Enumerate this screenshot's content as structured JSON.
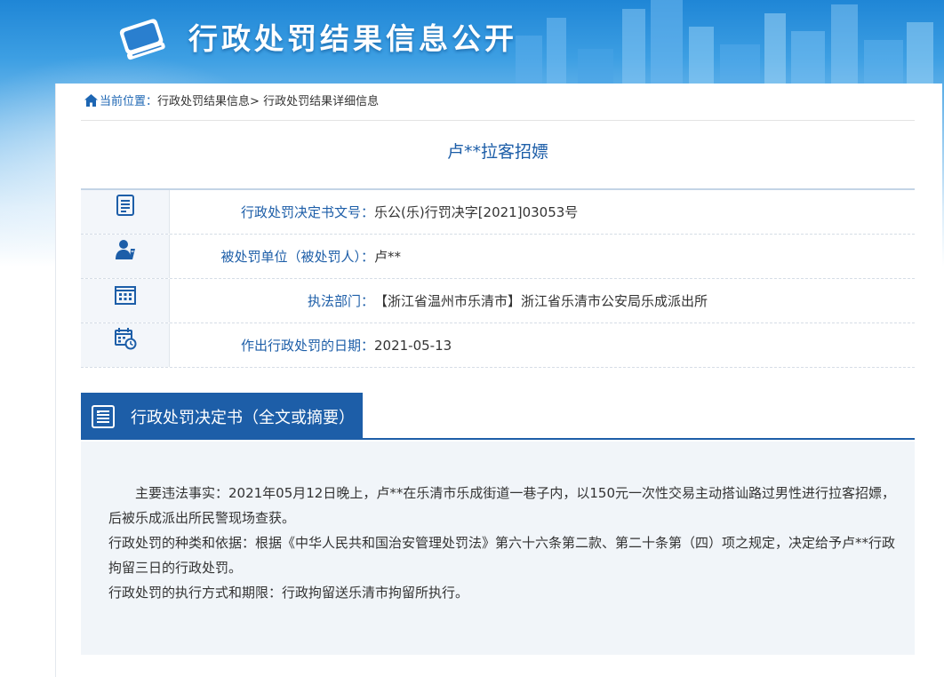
{
  "banner": {
    "title": "行政处罚结果信息公开"
  },
  "breadcrumb": {
    "current": "当前位置：",
    "level1": "行政处罚结果信息>",
    "level2": "行政处罚结果详细信息"
  },
  "page_title": "卢**拉客招嫖",
  "info": [
    {
      "icon": "document-icon",
      "label": "行政处罚决定书文号：",
      "value": "乐公(乐)行罚决字[2021]03053号"
    },
    {
      "icon": "person-icon",
      "label": "被处罚单位（被处罚人）：",
      "value": "卢**"
    },
    {
      "icon": "building-icon",
      "label": "执法部门：",
      "value": "【浙江省温州市乐清市】浙江省乐清市公安局乐成派出所"
    },
    {
      "icon": "calendar-icon",
      "label": "作出行政处罚的日期：",
      "value": "2021-05-13"
    }
  ],
  "section": {
    "title": "行政处罚决定书（全文或摘要）",
    "paragraphs": [
      "主要违法事实：2021年05月12日晚上，卢**在乐清市乐成街道一巷子内，以150元一次性交易主动搭讪路过男性进行拉客招嫖，后被乐成派出所民警现场查获。",
      "行政处罚的种类和依据：根据《中华人民共和国治安管理处罚法》第六十六条第二款、第二十条第（四）项之规定，决定给予卢**行政拘留三日的行政处罚。",
      "行政处罚的执行方式和期限：行政拘留送乐清市拘留所执行。"
    ]
  },
  "colors": {
    "brand_blue": "#1d5ea8",
    "banner_blue": "#1f86d6"
  }
}
